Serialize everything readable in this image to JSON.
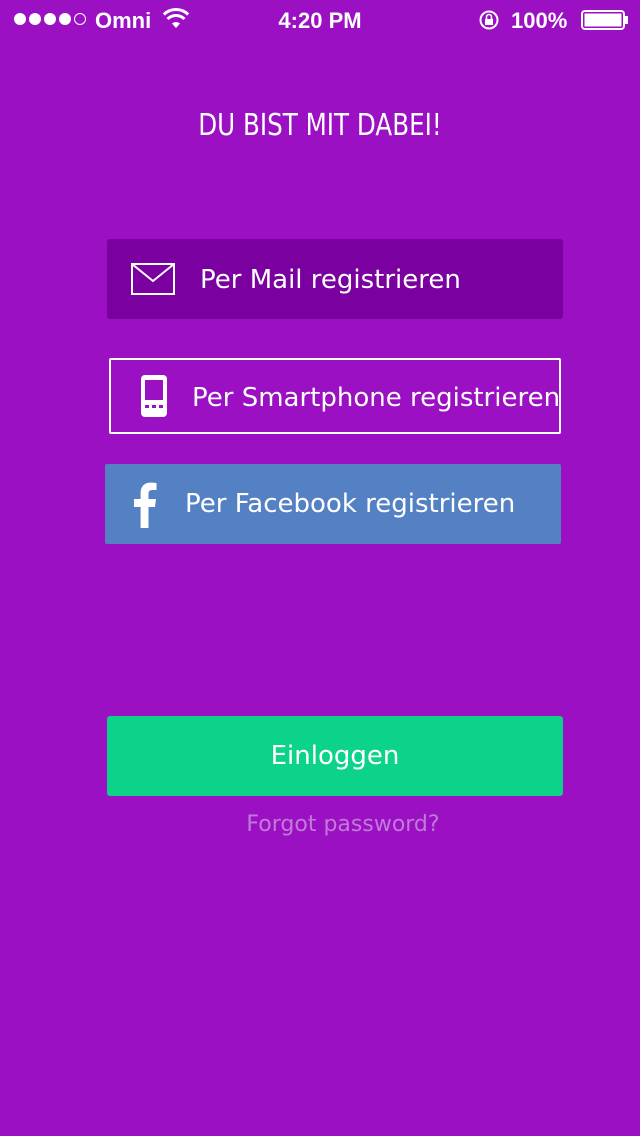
{
  "status_bar": {
    "carrier": "Omni",
    "time": "4:20 PM",
    "battery_percent": "100%",
    "signal_bars_filled": 4,
    "signal_bars_total": 5
  },
  "headline": "DU BIST MIT DABEI!",
  "register": {
    "mail": {
      "label": "Per Mail registrieren",
      "icon": "mail-icon"
    },
    "smartphone": {
      "label": "Per Smartphone registrieren",
      "icon": "smartphone-icon"
    },
    "facebook": {
      "label": "Per Facebook registrieren",
      "icon": "facebook-icon"
    }
  },
  "login": {
    "label": "Einloggen"
  },
  "forgot_password": "Forgot password?",
  "colors": {
    "background": "#9a10c2",
    "mail_button": "#7a00a0",
    "facebook_button": "#5481c4",
    "login_button": "#0bd48a",
    "forgot_text": "#c07ad9"
  }
}
